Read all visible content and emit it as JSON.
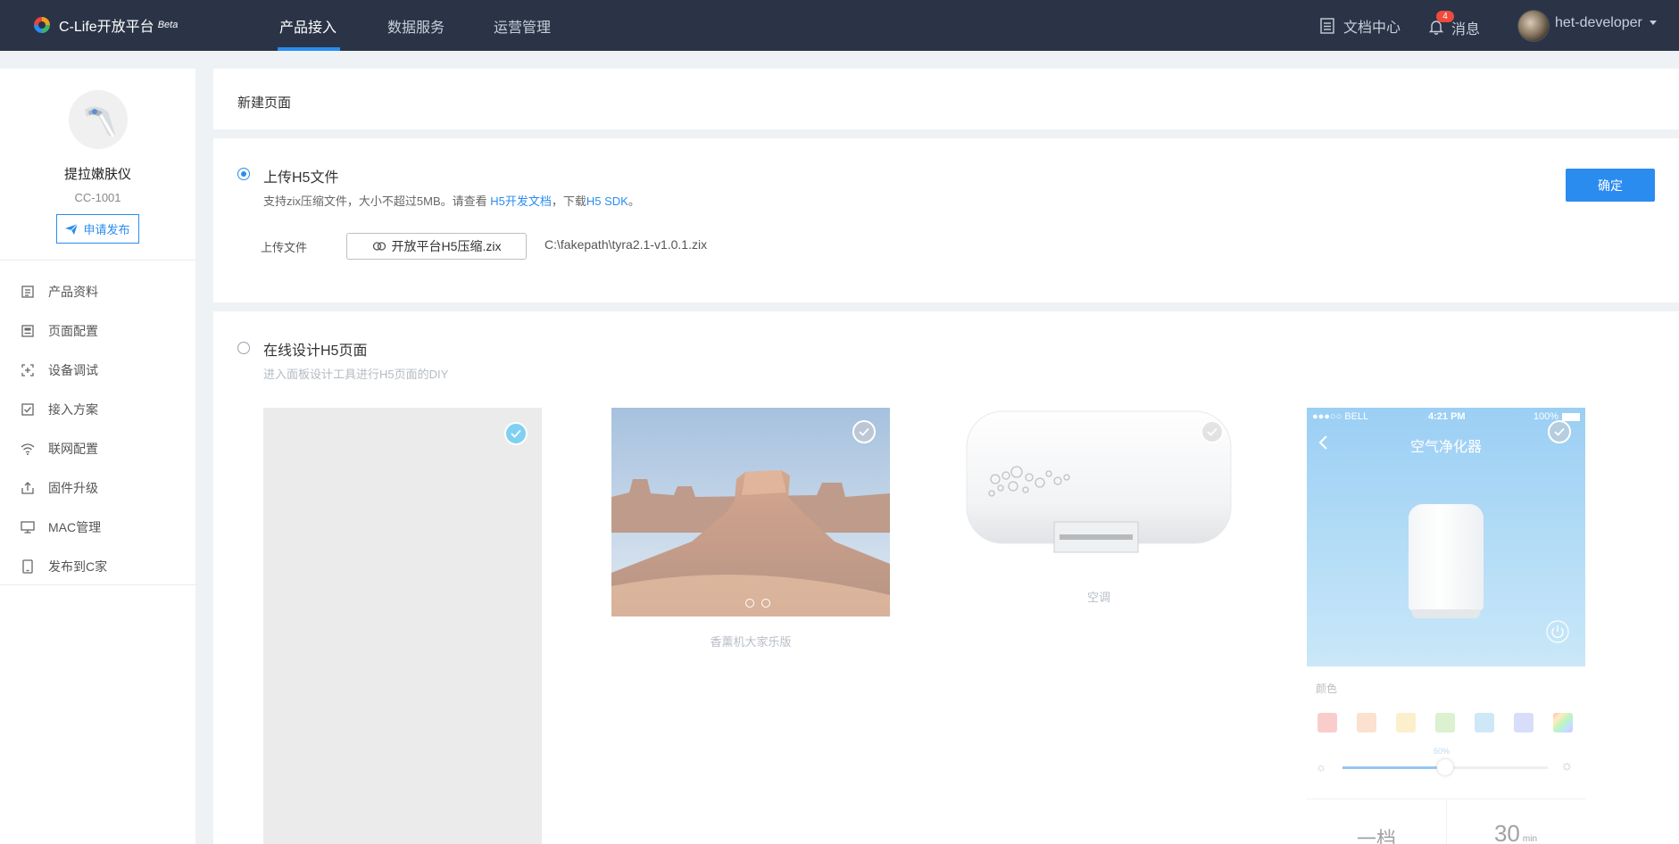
{
  "header": {
    "brand": "C-Life开放平台",
    "brand_tag": "Beta",
    "nav": [
      {
        "label": "产品接入",
        "active": true
      },
      {
        "label": "数据服务",
        "active": false
      },
      {
        "label": "运营管理",
        "active": false
      }
    ],
    "docs_label": "文档中心",
    "messages_label": "消息",
    "messages_count": "4",
    "username": "het-developer"
  },
  "sidebar": {
    "product_name": "提拉嫩肤仪",
    "product_id": "CC-1001",
    "publish_label": "申请发布",
    "menu": [
      {
        "label": "产品资料",
        "icon": "document-icon"
      },
      {
        "label": "页面配置",
        "icon": "page-icon"
      },
      {
        "label": "设备调试",
        "icon": "debug-icon"
      },
      {
        "label": "接入方案",
        "icon": "checkbox-icon"
      },
      {
        "label": "联网配置",
        "icon": "wifi-icon"
      },
      {
        "label": "固件升级",
        "icon": "upload-icon"
      },
      {
        "label": "MAC管理",
        "icon": "monitor-icon"
      },
      {
        "label": "发布到C家",
        "icon": "phone-icon"
      }
    ]
  },
  "page": {
    "title": "新建页面",
    "confirm_label": "确定",
    "upload_option": {
      "title": "上传H5文件",
      "desc_prefix": "支持zix压缩文件，大小不超过5MB。请查看 ",
      "desc_link1": "H5开发文档",
      "desc_mid": "，下载",
      "desc_link2": "H5 SDK",
      "desc_suffix": "。",
      "field_label": "上传文件",
      "file_button_label": "开放平台H5压缩.zix",
      "file_path": "C:\\fakepath\\tyra2.1-v1.0.1.zix"
    },
    "design_option": {
      "title": "在线设计H5页面",
      "desc": "进入面板设计工具进行H5页面的DIY"
    },
    "templates": [
      {
        "caption": "",
        "selected": true
      },
      {
        "caption": "香薰机大家乐版",
        "selected": false
      },
      {
        "caption": "空调",
        "selected": false
      },
      {
        "caption": "",
        "selected": false
      }
    ],
    "phone_mock": {
      "carrier": "●●●○○ BELL",
      "time": "4:21 PM",
      "battery": "100%",
      "title": "空气净化器",
      "color_label": "颜色",
      "slider_value": "50%",
      "gear_label": "一档",
      "timer_value": "30",
      "timer_unit": "min",
      "swatches": [
        "#f7a6a6",
        "#f8c9a8",
        "#fbe3a3",
        "#bfe7a9",
        "#a9d6f3",
        "#b9c3f5",
        "rainbow"
      ]
    }
  }
}
